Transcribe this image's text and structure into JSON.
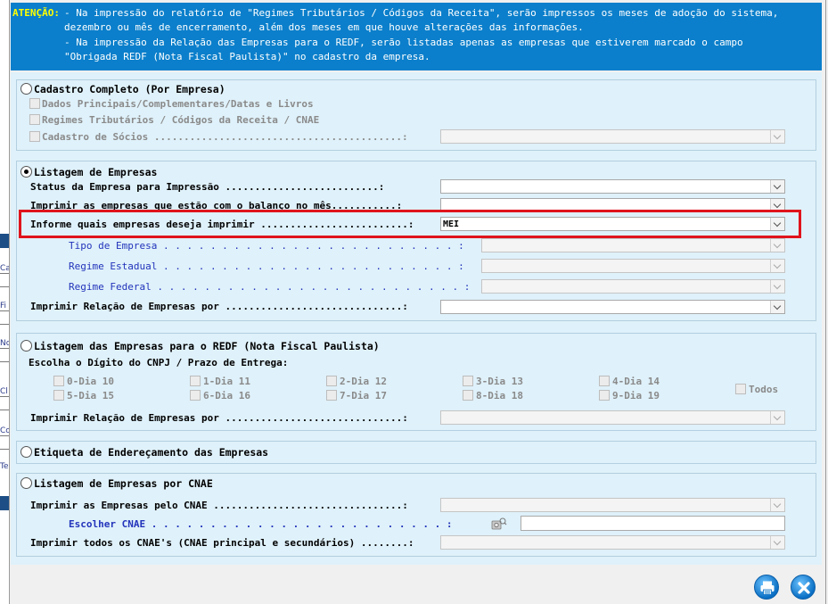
{
  "background_window": {
    "labels": [
      "C",
      "Ca",
      "Fi",
      "No",
      "Cl",
      "Co",
      "Te"
    ]
  },
  "warning": {
    "label": "ATENÇÃO:",
    "line1": "- Na impressão do relatório de \"Regimes Tributários / Códigos da Receita\", serão impressos os meses de adoção do sistema,",
    "line2": "dezembro ou mês de encerramento, além dos meses em que houve alterações das informações.",
    "line3": "- Na impressão da Relação das Empresas para o REDF, serão listadas apenas as empresas que estiverem marcado o campo",
    "line4": "\"Obrigada REDF (Nota Fiscal Paulista)\" no cadastro da empresa."
  },
  "sections": {
    "cadastro": {
      "title": "Cadastro Completo (Por Empresa)",
      "opt1": "Dados Principais/Complementares/Datas e Livros",
      "opt2": "Regimes Tributários / Códigos da Receita / CNAE",
      "opt3": "Cadastro de Sócios ..........................................:",
      "selected": false
    },
    "listagem": {
      "title": "Listagem de Empresas",
      "selected": true,
      "status_label": "Status da Empresa para Impressão ..........................:",
      "balanco_label": "Imprimir as empresas que estão com o balanço no mês...........:",
      "informe_label": "Informe quais empresas deseja imprimir .........................:",
      "informe_value": "MEI",
      "tipo_label": "Tipo de Empresa . . . . . . . . . . . . . . . . . . . . . . . . . :",
      "estadual_label": "Regime Estadual . . . . . . . . . . . . . . . . . . . . . . . . . :",
      "federal_label": "Regime Federal . . . . . . . . . . . . . . . . . . . . . . . . . . :",
      "relacao_label": "Imprimir Relação de Empresas por ..............................:"
    },
    "redf": {
      "title": "Listagem das Empresas para o REDF (Nota Fiscal Paulista)",
      "selected": false,
      "digito_label": "Escolha o Dígito do CNPJ / Prazo de Entrega:",
      "digits": [
        "0-Dia 10",
        "1-Dia 11",
        "2-Dia 12",
        "3-Dia 13",
        "4-Dia 14",
        "5-Dia 15",
        "6-Dia 16",
        "7-Dia 17",
        "8-Dia 18",
        "9-Dia 19"
      ],
      "todos": "Todos",
      "relacao_label": "Imprimir Relação de Empresas por ..............................:"
    },
    "etiqueta": {
      "title": "Etiqueta de Endereçamento das Empresas",
      "selected": false
    },
    "cnae": {
      "title": "Listagem de Empresas por CNAE",
      "selected": false,
      "pelo_label": "Imprimir as Empresas pelo CNAE ................................:",
      "escolher_label": "Escolher CNAE . . . . . . . . . . . . . . . . . . . . . . . . . :",
      "todos_label": "Imprimir todos os CNAE's (CNAE principal e secundários) ........:"
    }
  },
  "icons": {
    "print": "printer-icon",
    "close": "close-icon",
    "search": "search-gear-icon"
  },
  "colors": {
    "warning_bg": "#0b7fcb",
    "warning_label": "#ffff00",
    "content_bg": "#dff1fa",
    "highlight": "#e0141c"
  }
}
